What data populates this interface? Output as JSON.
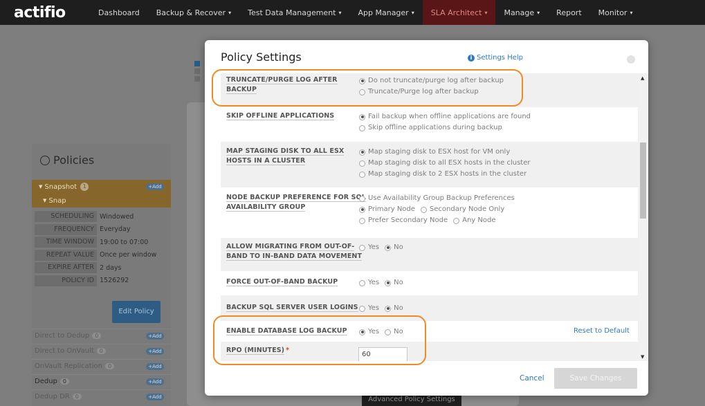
{
  "nav": {
    "logo": "actifio",
    "items": [
      {
        "label": "Dashboard",
        "caret": ""
      },
      {
        "label": "Backup & Recover",
        "caret": "▾"
      },
      {
        "label": "Test Data Management",
        "caret": "▾"
      },
      {
        "label": "App Manager",
        "caret": "▾"
      },
      {
        "label": "SLA Architect",
        "caret": "▾"
      },
      {
        "label": "Manage",
        "caret": "▾"
      },
      {
        "label": "Report",
        "caret": ""
      },
      {
        "label": "Monitor",
        "caret": "▾"
      }
    ],
    "active": "SLA Architect"
  },
  "background": {
    "policies_title": "Policies",
    "snapshot_label": "Snapshot",
    "snapshot_count": "1",
    "add_label": "+Add",
    "snap_label": "Snap",
    "details": [
      {
        "key": "SCHEDULING",
        "value": "Windowed"
      },
      {
        "key": "FREQUENCY",
        "value": "Everyday"
      },
      {
        "key": "TIME WINDOW",
        "value": "19:00 to 07:00"
      },
      {
        "key": "REPEAT VALUE",
        "value": "Once per window"
      },
      {
        "key": "EXPIRE AFTER",
        "value": "2 days"
      },
      {
        "key": "POLICY ID",
        "value": "1526292"
      }
    ],
    "edit_policy": "Edit Policy",
    "rows": [
      {
        "label": "Direct to Dedup",
        "count": "0"
      },
      {
        "label": "Direct to OnVault",
        "count": "0"
      },
      {
        "label": "OnVault Replication",
        "count": "0"
      },
      {
        "label": "Dedup",
        "count": "0"
      },
      {
        "label": "Dedup DR",
        "count": "0"
      }
    ],
    "advanced_button": "Advanced Policy Settings"
  },
  "modal": {
    "title": "Policy Settings",
    "help_link": "Settings Help",
    "settings": [
      {
        "label_lines": [
          "TRUNCATE/PURGE LOG AFTER",
          "BACKUP"
        ],
        "options": [
          {
            "label": "Do not truncate/purge log after backup",
            "selected": true
          },
          {
            "label": "Truncate/Purge log after backup",
            "selected": false
          }
        ]
      },
      {
        "label_lines": [
          "SKIP OFFLINE APPLICATIONS"
        ],
        "options": [
          {
            "label": "Fail backup when offline applications are found",
            "selected": true
          },
          {
            "label": "Skip offline applications during backup",
            "selected": false
          }
        ]
      },
      {
        "label_lines": [
          "MAP STAGING DISK TO ALL ESX",
          "HOSTS IN A CLUSTER"
        ],
        "options": [
          {
            "label": "Map staging disk to ESX host for VM only",
            "selected": true
          },
          {
            "label": "Map staging disk to all ESX hosts in the cluster",
            "selected": false
          },
          {
            "label": "Map staging disk to 2 ESX hosts in the cluster",
            "selected": false
          }
        ]
      },
      {
        "label_lines": [
          "NODE BACKUP PREFERENCE FOR SQL",
          "AVAILABILITY GROUP"
        ],
        "options": [
          {
            "label": "Use Availability Group Backup Preferences",
            "selected": false
          },
          {
            "label": "Primary Node",
            "selected": true
          },
          {
            "label": "Secondary Node Only",
            "selected": false
          },
          {
            "label": "Prefer Secondary Node",
            "selected": false
          },
          {
            "label": "Any Node",
            "selected": false
          }
        ]
      },
      {
        "label_lines": [
          "ALLOW MIGRATING FROM OUT-OF-",
          "BAND TO IN-BAND DATA MOVEMENT"
        ],
        "options": [
          {
            "label": "Yes",
            "selected": false
          },
          {
            "label": "No",
            "selected": true
          }
        ]
      },
      {
        "label_lines": [
          "FORCE OUT-OF-BAND BACKUP"
        ],
        "options": [
          {
            "label": "Yes",
            "selected": false
          },
          {
            "label": "No",
            "selected": true
          }
        ]
      },
      {
        "label_lines": [
          "BACKUP SQL SERVER USER LOGINS"
        ],
        "options": [
          {
            "label": "Yes",
            "selected": false
          },
          {
            "label": "No",
            "selected": true
          }
        ]
      },
      {
        "label_lines": [
          "ENABLE DATABASE LOG BACKUP"
        ],
        "options": [
          {
            "label": "Yes",
            "selected": true
          },
          {
            "label": "No",
            "selected": false
          }
        ],
        "reset_label": "Reset to Default"
      },
      {
        "label_lines": [
          "RPO (MINUTES)"
        ],
        "required_mark": "*",
        "input_value": "60"
      }
    ],
    "cancel_label": "Cancel",
    "save_label": "Save Changes",
    "scroll_up": "▲",
    "scroll_down": "▼"
  },
  "colors": {
    "accent": "#2d79bf",
    "highlight": "#f28a23",
    "active_nav": "#5a1616"
  }
}
